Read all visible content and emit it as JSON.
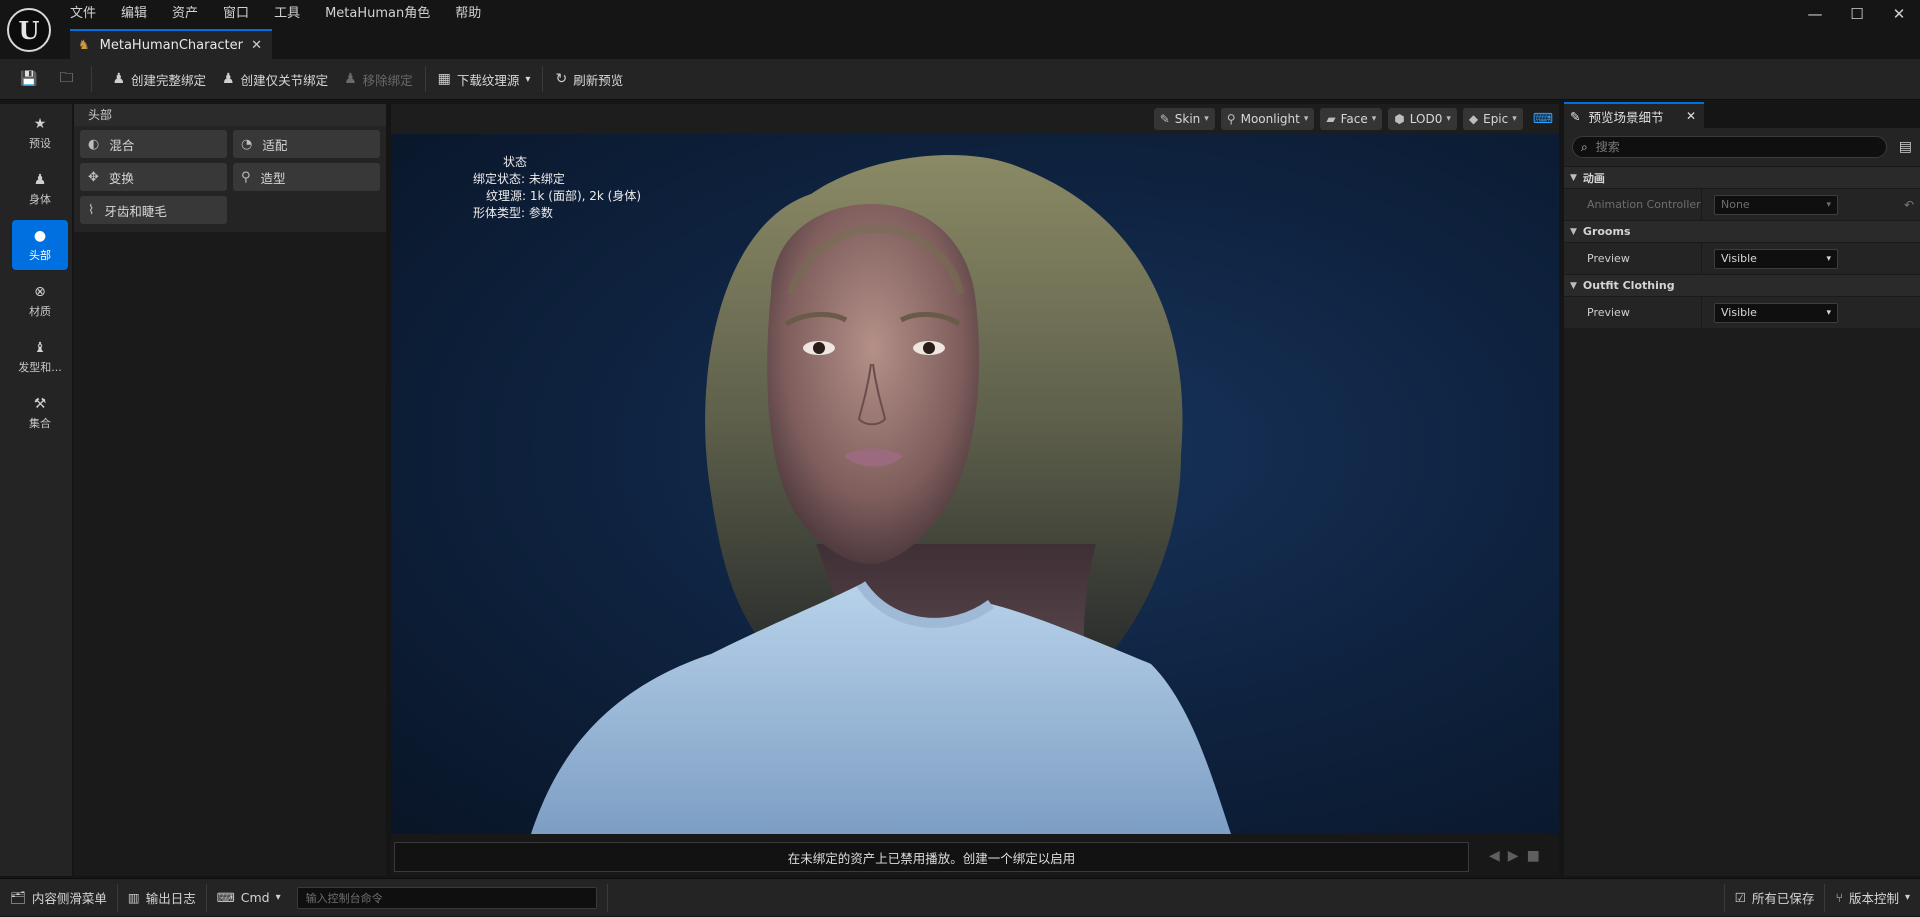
{
  "app": {
    "logo_text": "U"
  },
  "menu": [
    "文件",
    "编辑",
    "资产",
    "窗口",
    "工具",
    "MetaHuman角色",
    "帮助"
  ],
  "window_controls": {
    "minimize": "—",
    "maximize": "☐",
    "close": "✕"
  },
  "document_tab": {
    "title": "MetaHumanCharacter",
    "close": "✕"
  },
  "toolbar": {
    "create_full_rig": "创建完整绑定",
    "create_joint_rig": "创建仅关节绑定",
    "remove_rig": "移除绑定",
    "download_texture": "下载纹理源",
    "refresh_preview": "刷新预览"
  },
  "left_nav": [
    {
      "label": "预设",
      "icon": "star-icon",
      "glyph": "★"
    },
    {
      "label": "身体",
      "icon": "body-icon",
      "glyph": "♟"
    },
    {
      "label": "头部",
      "icon": "head-icon",
      "glyph": "●"
    },
    {
      "label": "材质",
      "icon": "material-icon",
      "glyph": "⊗"
    },
    {
      "label": "发型和...",
      "icon": "hair-icon",
      "glyph": "♝"
    },
    {
      "label": "集合",
      "icon": "hammer-icon",
      "glyph": "⚒"
    }
  ],
  "head_panel": {
    "title": "头部",
    "tools": [
      {
        "label": "混合",
        "glyph": "◐"
      },
      {
        "label": "适配",
        "glyph": "◔"
      },
      {
        "label": "变换",
        "glyph": "✥"
      },
      {
        "label": "造型",
        "glyph": "⚲"
      },
      {
        "label": "牙齿和睫毛",
        "glyph": "⌇"
      }
    ]
  },
  "viewport": {
    "buttons": [
      {
        "label": "Skin",
        "glyph": "✎"
      },
      {
        "label": "Moonlight",
        "glyph": "⚲"
      },
      {
        "label": "Face",
        "glyph": "▰"
      },
      {
        "label": "LOD0",
        "glyph": "⬢"
      },
      {
        "label": "Epic",
        "glyph": "◆"
      }
    ],
    "status": {
      "title": "状态",
      "line1": "绑定状态: 未绑定",
      "line2": "纹理源: 1k (面部), 2k (身体)",
      "line3": "形体类型: 参数"
    },
    "notice": "在未绑定的资产上已禁用播放。创建一个绑定以启用"
  },
  "details_panel": {
    "tab_title": "预览场景细节",
    "search_placeholder": "搜索",
    "categories": [
      {
        "title": "动画",
        "rows": [
          {
            "name": "Animation Controller",
            "value": "None",
            "disabled": true
          }
        ]
      },
      {
        "title": "Grooms",
        "rows": [
          {
            "name": "Preview",
            "value": "Visible",
            "disabled": false
          }
        ]
      },
      {
        "title": "Outfit Clothing",
        "rows": [
          {
            "name": "Preview",
            "value": "Visible",
            "disabled": false
          }
        ]
      }
    ]
  },
  "statusbar": {
    "content_drawer": "内容侧滑菜单",
    "output_log": "输出日志",
    "cmd": "Cmd",
    "cmd_placeholder": "输入控制台命令",
    "all_saved": "所有已保存",
    "source_control": "版本控制"
  },
  "colors": {
    "accent": "#0070e0",
    "viewport_bg": "#0f2442",
    "panel": "#242424"
  }
}
